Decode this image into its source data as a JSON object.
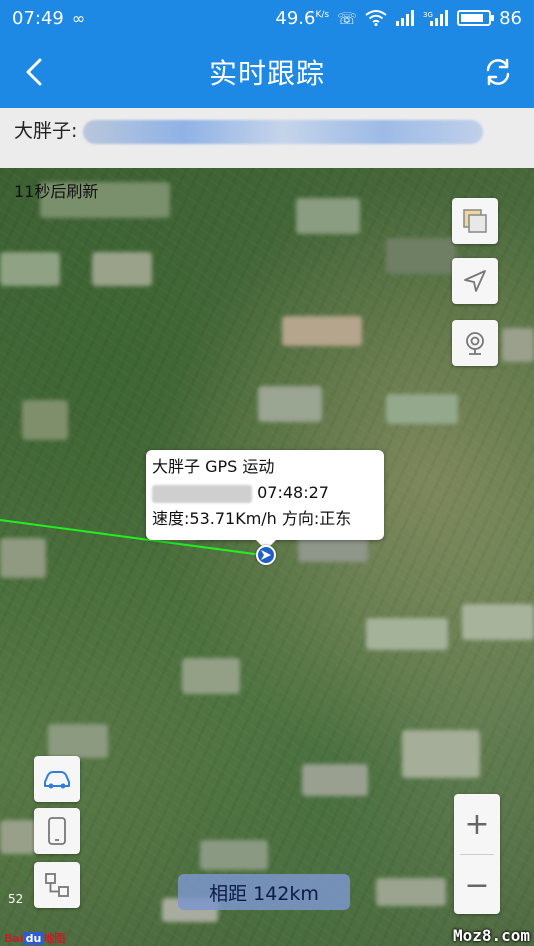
{
  "status_bar": {
    "time": "07:49",
    "infinity_icon": "infinity-icon",
    "network_speed": "49.6",
    "network_speed_unit": "K/s",
    "icons": [
      "nfc-icon",
      "wifi-icon",
      "signal-icon",
      "3g-signal-icon"
    ],
    "battery": "86",
    "battery_level_fraction": 0.86
  },
  "app_bar": {
    "back_icon": "back-arrow-icon",
    "title": "实时跟踪",
    "refresh_icon": "refresh-icon"
  },
  "info_bar": {
    "name_label": "大胖子:"
  },
  "map": {
    "refresh_countdown": "11秒后刷新",
    "layer_icon": "map-layers-icon",
    "locate_icon": "navigate-arrow-icon",
    "camera_icon": "webcam-icon",
    "callout": {
      "name": "大胖子",
      "gps_state": "GPS 运动",
      "time": "07:48:27",
      "speed": "速度:53.71Km/h",
      "direction": "方向:正东"
    },
    "track_color": "#22ee22",
    "bottom_left_controls": [
      "car-icon",
      "phone-icon",
      "route-nodes-icon"
    ],
    "zoom_in": "+",
    "zoom_out": "−",
    "distance": "相距 142km",
    "scale_number": "52",
    "logo": {
      "bai": "Bai",
      "du": "du",
      "map": "地图"
    },
    "watermark": "Moz8.com"
  },
  "colors": {
    "primary": "#1e88e5",
    "marker": "#1e60c8",
    "distance_bg": "#7d96cd"
  }
}
